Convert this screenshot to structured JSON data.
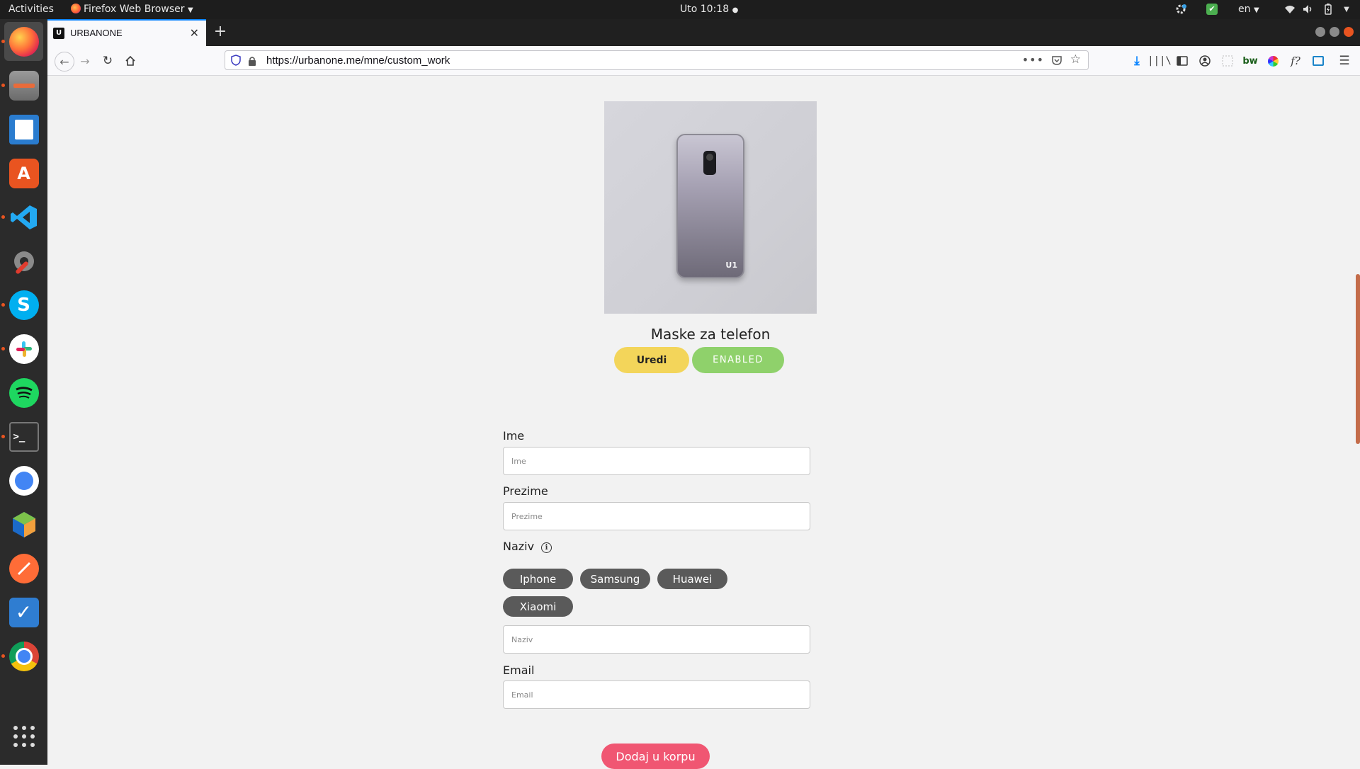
{
  "topbar": {
    "activities": "Activities",
    "app_menu": "Firefox Web Browser",
    "clock": "Uto 10:18",
    "language": "en"
  },
  "browser": {
    "tab_title": "URBANONE",
    "url": "https://urbanone.me/mne/custom_work"
  },
  "product": {
    "title": "Maske za telefon",
    "edit_label": "Uredi",
    "status_label": "ENABLED",
    "image_logo": "U1"
  },
  "form": {
    "first_name_label": "Ime",
    "first_name_placeholder": "Ime",
    "last_name_label": "Prezime",
    "last_name_placeholder": "Prezime",
    "model_label": "Naziv",
    "model_placeholder": "Naziv",
    "model_chips": [
      "Iphone",
      "Samsung",
      "Huawei",
      "Xiaomi"
    ],
    "email_label": "Email",
    "email_placeholder": "Email",
    "submit_label": "Dodaj u korpu"
  },
  "colors": {
    "edit_button": "#f3d55a",
    "enabled_badge": "#8fd16b",
    "chip": "#5a5a5a",
    "submit_button": "#f05672",
    "ubuntu_accent": "#e95420"
  }
}
